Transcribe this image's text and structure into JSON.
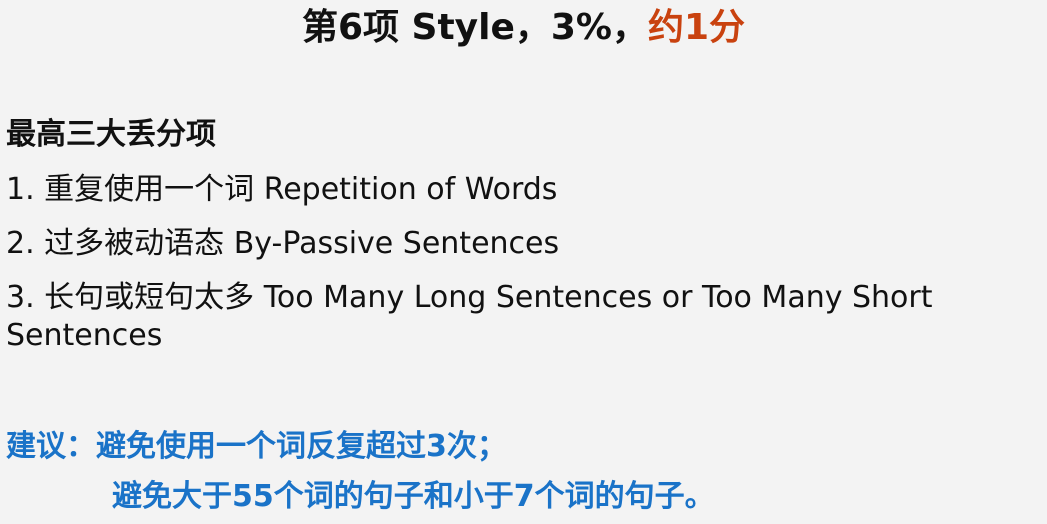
{
  "title": {
    "main": "第6项 Style，3%，",
    "accent": "约1分",
    "accent_color": "#c9420f"
  },
  "section": {
    "heading": "最高三大丢分项",
    "items": [
      "1. 重复使用一个词 Repetition of Words",
      "2. 过多被动语态 By-Passive Sentences",
      "3. 长句或短句太多 Too Many Long Sentences or Too Many Short",
      "Sentences"
    ]
  },
  "advice": {
    "label": "建议：",
    "line1": "避免使用一个词反复超过3次；",
    "line2": "避免大于55个词的句子和小于7个词的句子。",
    "color": "#1a73c8"
  }
}
